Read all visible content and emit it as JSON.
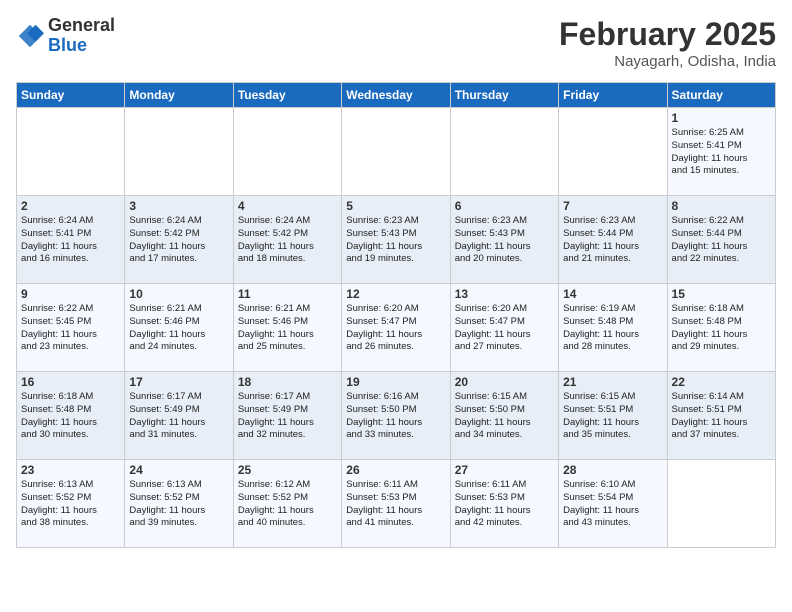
{
  "logo": {
    "general": "General",
    "blue": "Blue"
  },
  "title": "February 2025",
  "subtitle": "Nayagarh, Odisha, India",
  "days_of_week": [
    "Sunday",
    "Monday",
    "Tuesday",
    "Wednesday",
    "Thursday",
    "Friday",
    "Saturday"
  ],
  "weeks": [
    [
      {
        "day": "",
        "info": ""
      },
      {
        "day": "",
        "info": ""
      },
      {
        "day": "",
        "info": ""
      },
      {
        "day": "",
        "info": ""
      },
      {
        "day": "",
        "info": ""
      },
      {
        "day": "",
        "info": ""
      },
      {
        "day": "1",
        "info": "Sunrise: 6:25 AM\nSunset: 5:41 PM\nDaylight: 11 hours\nand 15 minutes."
      }
    ],
    [
      {
        "day": "2",
        "info": "Sunrise: 6:24 AM\nSunset: 5:41 PM\nDaylight: 11 hours\nand 16 minutes."
      },
      {
        "day": "3",
        "info": "Sunrise: 6:24 AM\nSunset: 5:42 PM\nDaylight: 11 hours\nand 17 minutes."
      },
      {
        "day": "4",
        "info": "Sunrise: 6:24 AM\nSunset: 5:42 PM\nDaylight: 11 hours\nand 18 minutes."
      },
      {
        "day": "5",
        "info": "Sunrise: 6:23 AM\nSunset: 5:43 PM\nDaylight: 11 hours\nand 19 minutes."
      },
      {
        "day": "6",
        "info": "Sunrise: 6:23 AM\nSunset: 5:43 PM\nDaylight: 11 hours\nand 20 minutes."
      },
      {
        "day": "7",
        "info": "Sunrise: 6:23 AM\nSunset: 5:44 PM\nDaylight: 11 hours\nand 21 minutes."
      },
      {
        "day": "8",
        "info": "Sunrise: 6:22 AM\nSunset: 5:44 PM\nDaylight: 11 hours\nand 22 minutes."
      }
    ],
    [
      {
        "day": "9",
        "info": "Sunrise: 6:22 AM\nSunset: 5:45 PM\nDaylight: 11 hours\nand 23 minutes."
      },
      {
        "day": "10",
        "info": "Sunrise: 6:21 AM\nSunset: 5:46 PM\nDaylight: 11 hours\nand 24 minutes."
      },
      {
        "day": "11",
        "info": "Sunrise: 6:21 AM\nSunset: 5:46 PM\nDaylight: 11 hours\nand 25 minutes."
      },
      {
        "day": "12",
        "info": "Sunrise: 6:20 AM\nSunset: 5:47 PM\nDaylight: 11 hours\nand 26 minutes."
      },
      {
        "day": "13",
        "info": "Sunrise: 6:20 AM\nSunset: 5:47 PM\nDaylight: 11 hours\nand 27 minutes."
      },
      {
        "day": "14",
        "info": "Sunrise: 6:19 AM\nSunset: 5:48 PM\nDaylight: 11 hours\nand 28 minutes."
      },
      {
        "day": "15",
        "info": "Sunrise: 6:18 AM\nSunset: 5:48 PM\nDaylight: 11 hours\nand 29 minutes."
      }
    ],
    [
      {
        "day": "16",
        "info": "Sunrise: 6:18 AM\nSunset: 5:48 PM\nDaylight: 11 hours\nand 30 minutes."
      },
      {
        "day": "17",
        "info": "Sunrise: 6:17 AM\nSunset: 5:49 PM\nDaylight: 11 hours\nand 31 minutes."
      },
      {
        "day": "18",
        "info": "Sunrise: 6:17 AM\nSunset: 5:49 PM\nDaylight: 11 hours\nand 32 minutes."
      },
      {
        "day": "19",
        "info": "Sunrise: 6:16 AM\nSunset: 5:50 PM\nDaylight: 11 hours\nand 33 minutes."
      },
      {
        "day": "20",
        "info": "Sunrise: 6:15 AM\nSunset: 5:50 PM\nDaylight: 11 hours\nand 34 minutes."
      },
      {
        "day": "21",
        "info": "Sunrise: 6:15 AM\nSunset: 5:51 PM\nDaylight: 11 hours\nand 35 minutes."
      },
      {
        "day": "22",
        "info": "Sunrise: 6:14 AM\nSunset: 5:51 PM\nDaylight: 11 hours\nand 37 minutes."
      }
    ],
    [
      {
        "day": "23",
        "info": "Sunrise: 6:13 AM\nSunset: 5:52 PM\nDaylight: 11 hours\nand 38 minutes."
      },
      {
        "day": "24",
        "info": "Sunrise: 6:13 AM\nSunset: 5:52 PM\nDaylight: 11 hours\nand 39 minutes."
      },
      {
        "day": "25",
        "info": "Sunrise: 6:12 AM\nSunset: 5:52 PM\nDaylight: 11 hours\nand 40 minutes."
      },
      {
        "day": "26",
        "info": "Sunrise: 6:11 AM\nSunset: 5:53 PM\nDaylight: 11 hours\nand 41 minutes."
      },
      {
        "day": "27",
        "info": "Sunrise: 6:11 AM\nSunset: 5:53 PM\nDaylight: 11 hours\nand 42 minutes."
      },
      {
        "day": "28",
        "info": "Sunrise: 6:10 AM\nSunset: 5:54 PM\nDaylight: 11 hours\nand 43 minutes."
      },
      {
        "day": "",
        "info": ""
      }
    ]
  ]
}
